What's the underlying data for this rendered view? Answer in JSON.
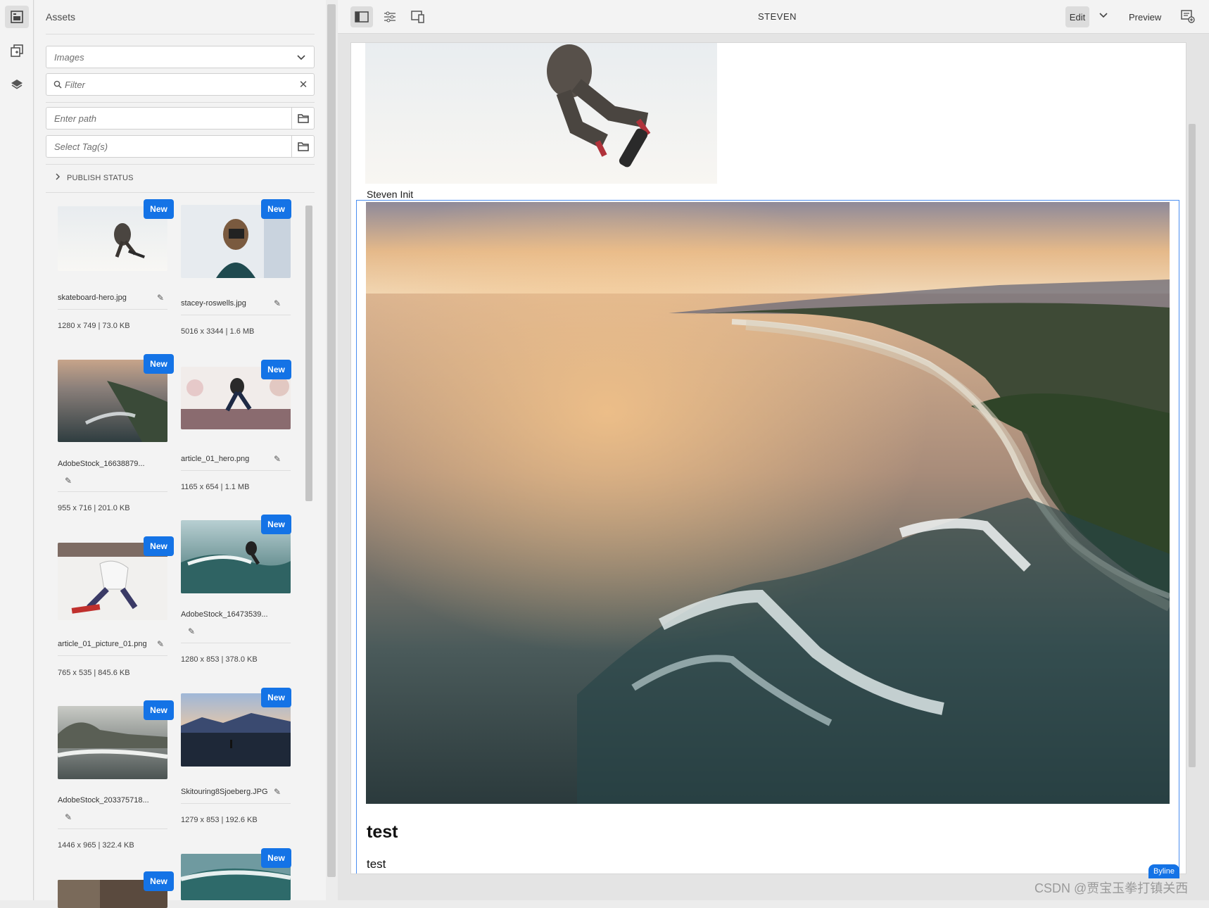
{
  "rail": {
    "items": [
      "assets-icon",
      "components-icon",
      "layers-icon"
    ]
  },
  "panel": {
    "title": "Assets",
    "type_select": {
      "value": "Images"
    },
    "filter": {
      "placeholder": "Filter"
    },
    "path": {
      "placeholder": "Enter path"
    },
    "tags": {
      "placeholder": "Select Tag(s)"
    },
    "publish_status": "PUBLISH STATUS",
    "badge": "New",
    "assets": [
      {
        "name": "skateboard-hero.jpg",
        "meta": "1280 x 749 | 73.0 KB"
      },
      {
        "name": "stacey-roswells.jpg",
        "meta": "5016 x 3344 | 1.6 MB"
      },
      {
        "name": "AdobeStock_16638879...",
        "meta": "955 x 716 | 201.0 KB"
      },
      {
        "name": "article_01_hero.png",
        "meta": "1165 x 654 | 1.1 MB"
      },
      {
        "name": "article_01_picture_01.png",
        "meta": "765 x 535 | 845.6 KB"
      },
      {
        "name": "AdobeStock_16473539...",
        "meta": "1280 x 853 | 378.0 KB"
      },
      {
        "name": "AdobeStock_203375718...",
        "meta": "1446 x 965 | 322.4 KB"
      },
      {
        "name": "Skitouring8Sjoeberg.JPG",
        "meta": "1279 x 853 | 192.6 KB"
      },
      {
        "name": "",
        "meta": ""
      },
      {
        "name": "",
        "meta": ""
      }
    ]
  },
  "toolbar": {
    "page_name": "STEVEN",
    "mode": "Edit",
    "preview": "Preview"
  },
  "page": {
    "byline_text": "Steven Init",
    "heading": "test",
    "paragraph": "test",
    "component_tag": "Byline"
  },
  "watermark": "CSDN @贾宝玉拳打镇关西",
  "colors": {
    "accent": "#1473e6",
    "selection": "#4a8ef0"
  }
}
